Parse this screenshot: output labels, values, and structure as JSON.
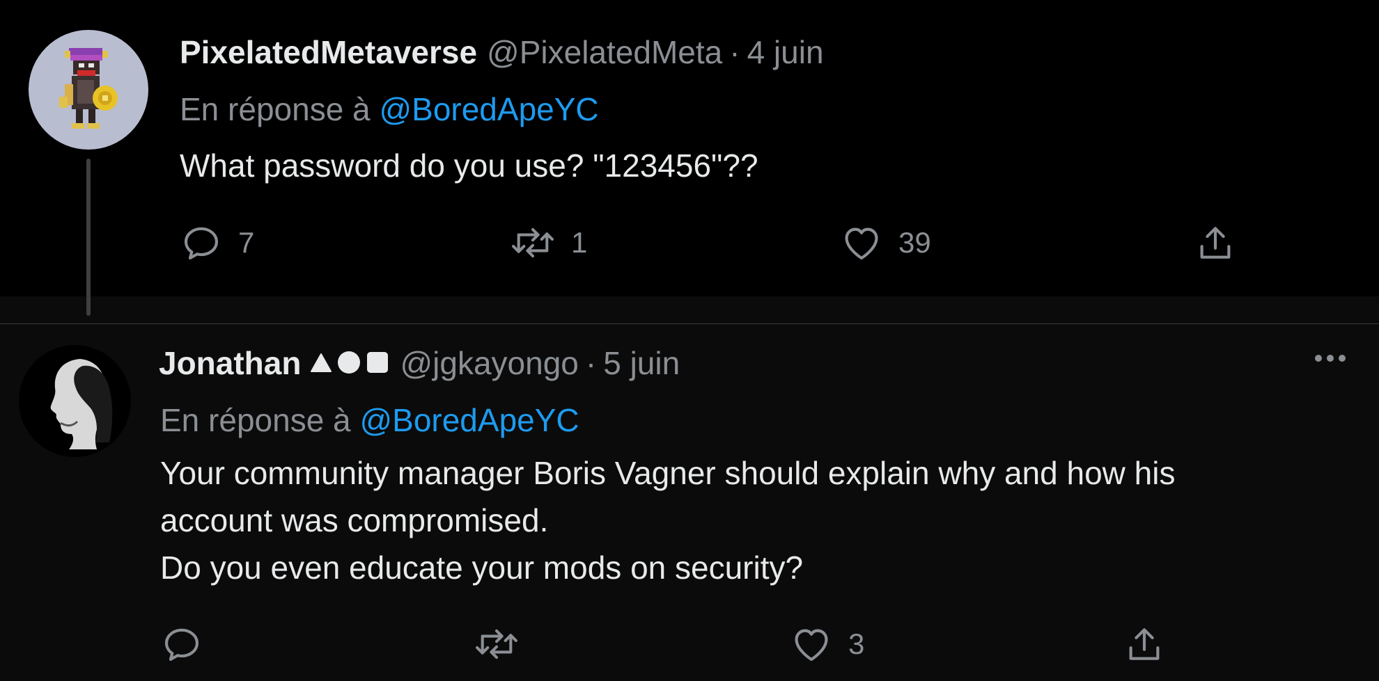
{
  "tweets": [
    {
      "display_name": "PixelatedMetaverse",
      "handle": "@PixelatedMeta",
      "separator": "·",
      "date": "4 juin",
      "reply_prefix": "En réponse à",
      "reply_mention": "@BoredApeYC",
      "body": [
        "What password do you use? \"123456\"??"
      ],
      "actions": {
        "reply_count": "7",
        "retweet_count": "1",
        "like_count": "39"
      }
    },
    {
      "display_name": "Jonathan",
      "name_shapes": [
        "triangle",
        "circle",
        "square"
      ],
      "handle": "@jgkayongo",
      "separator": "·",
      "date": "5 juin",
      "reply_prefix": "En réponse à",
      "reply_mention": "@BoredApeYC",
      "body": [
        "Your community manager Boris Vagner should explain why and how his",
        "account was compromised.",
        "Do you even educate your mods on security?"
      ],
      "actions": {
        "reply_count": "",
        "retweet_count": "",
        "like_count": "3"
      }
    }
  ],
  "icons": {
    "reply": "reply-icon",
    "retweet": "retweet-icon",
    "like": "heart-icon",
    "share": "share-icon",
    "more": "more-icon"
  },
  "colors": {
    "background": "#000000",
    "reply_background": "#0b0b0b",
    "text": "#e7e9ea",
    "secondary": "#8b8f94",
    "accent": "#1d9bf0"
  }
}
